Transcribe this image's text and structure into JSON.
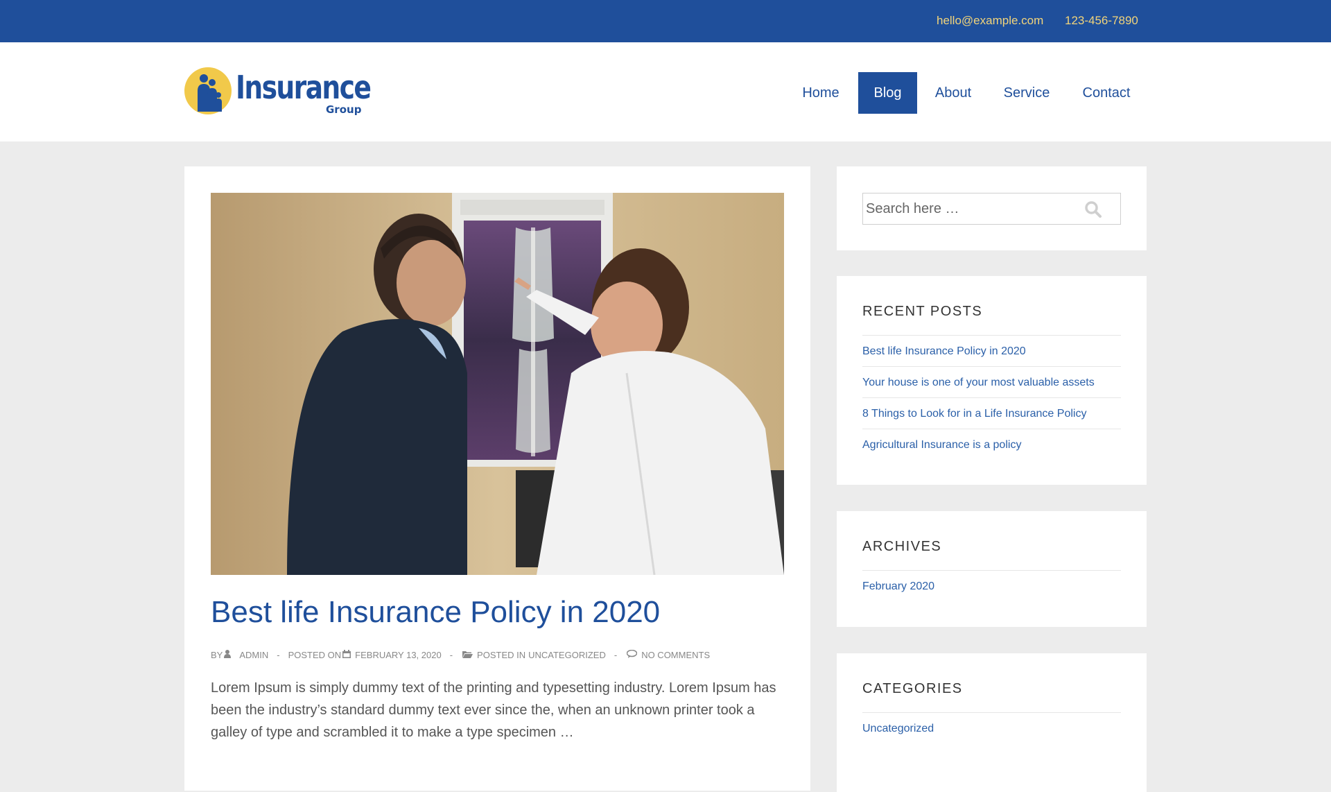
{
  "topbar": {
    "email": "hello@example.com",
    "phone": "123-456-7890"
  },
  "logo": {
    "title": "Insurance",
    "subtitle": "Group"
  },
  "nav": {
    "items": [
      {
        "label": "Home",
        "active": false
      },
      {
        "label": "Blog",
        "active": true
      },
      {
        "label": "About",
        "active": false
      },
      {
        "label": "Service",
        "active": false
      },
      {
        "label": "Contact",
        "active": false
      }
    ]
  },
  "post": {
    "title": "Best life Insurance Policy in 2020",
    "meta": {
      "by_label": "BY",
      "author": "ADMIN",
      "posted_on_label": "POSTED ON",
      "date": "FEBRUARY 13, 2020",
      "posted_in_label": "POSTED IN",
      "category": "UNCATEGORIZED",
      "comments": "NO COMMENTS",
      "separator": "-"
    },
    "excerpt": "Lorem Ipsum is simply dummy text of the printing and typesetting industry. Lorem Ipsum has been the industry’s standard dummy text ever since the, when an unknown printer took a galley of type and scrambled it to make a type specimen …"
  },
  "sidebar": {
    "search": {
      "placeholder": "Search here …",
      "icon": "search-icon"
    },
    "recent_posts": {
      "title": "RECENT POSTS",
      "items": [
        "Best life Insurance Policy in 2020",
        "Your house is one of your most valuable assets",
        "8 Things to Look for in a Life Insurance Policy",
        "Agricultural Insurance is a policy"
      ]
    },
    "archives": {
      "title": "ARCHIVES",
      "items": [
        "February 2020"
      ]
    },
    "categories": {
      "title": "CATEGORIES",
      "items": [
        "Uncategorized"
      ]
    }
  },
  "colors": {
    "brand_blue": "#1f4f9b",
    "accent_yellow": "#f2d47a",
    "link_blue": "#2a5fa8",
    "page_bg": "#ececec"
  }
}
